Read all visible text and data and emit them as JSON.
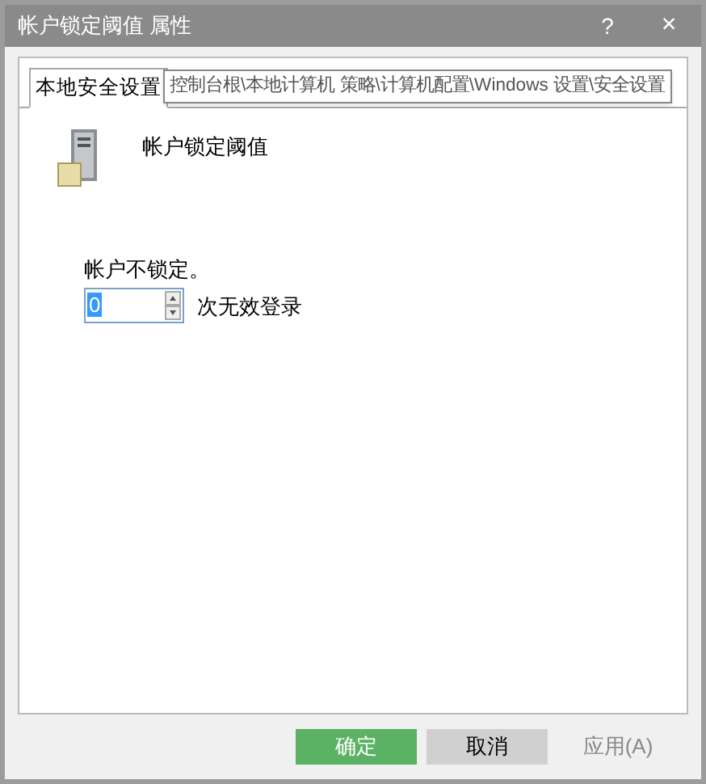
{
  "window": {
    "title": "帐户锁定阈值 属性",
    "help": "?",
    "close": "×"
  },
  "tabs": [
    {
      "label": "本地安全设置",
      "selected": true
    }
  ],
  "tooltip": "控制台根\\本地计算机 策略\\计算机配置\\Windows 设置\\安全设置",
  "policy": {
    "name": "帐户锁定阈值",
    "status": "帐户不锁定。",
    "value": "0",
    "unit": "次无效登录"
  },
  "buttons": [
    {
      "label": "确定",
      "kind": "primary"
    },
    {
      "label": "取消",
      "kind": "secondary"
    },
    {
      "label": "应用(A)",
      "kind": "disabled"
    }
  ]
}
